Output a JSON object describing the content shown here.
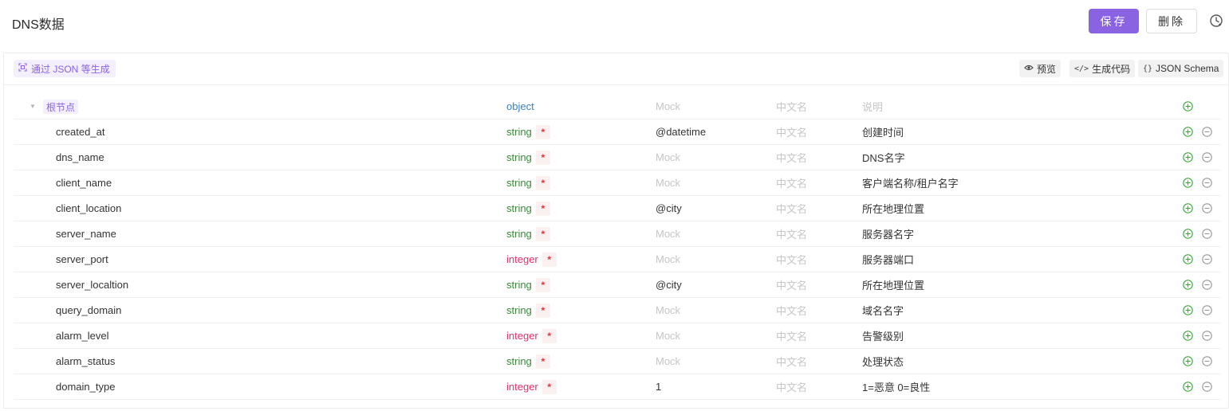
{
  "header": {
    "title": "DNS数据",
    "save_label": "保存",
    "delete_label": "删除",
    "history_icon": "history-icon"
  },
  "toolbar": {
    "generate_label": "通过 JSON 等生成",
    "preview_label": "预览",
    "codegen_label": "生成代码",
    "schema_label": "JSON Schema"
  },
  "colors": {
    "accent": "#8a63e3",
    "object_type": "#3b82c4",
    "string_type": "#3a8a3a",
    "integer_type": "#e2336e",
    "required": "#e0353b",
    "add_icon": "#3aa83a"
  },
  "schema": {
    "root": {
      "label": "根节点",
      "type": "object",
      "mock_placeholder": "Mock",
      "cn_placeholder": "中文名",
      "desc_placeholder": "说明"
    },
    "fields": [
      {
        "name": "created_at",
        "type": "string",
        "required": "*",
        "mock": "@datetime",
        "cn": "中文名",
        "desc": "创建时间"
      },
      {
        "name": "dns_name",
        "type": "string",
        "required": "*",
        "mock": "Mock",
        "cn": "中文名",
        "desc": "DNS名字"
      },
      {
        "name": "client_name",
        "type": "string",
        "required": "*",
        "mock": "Mock",
        "cn": "中文名",
        "desc": "客户端名称/租户名字"
      },
      {
        "name": "client_location",
        "type": "string",
        "required": "*",
        "mock": "@city",
        "cn": "中文名",
        "desc": "所在地理位置"
      },
      {
        "name": "server_name",
        "type": "string",
        "required": "*",
        "mock": "Mock",
        "cn": "中文名",
        "desc": "服务器名字"
      },
      {
        "name": "server_port",
        "type": "integer",
        "required": "*",
        "mock": "Mock",
        "cn": "中文名",
        "desc": "服务器端口"
      },
      {
        "name": "server_localtion",
        "type": "string",
        "required": "*",
        "mock": "@city",
        "cn": "中文名",
        "desc": "所在地理位置"
      },
      {
        "name": "query_domain",
        "type": "string",
        "required": "*",
        "mock": "Mock",
        "cn": "中文名",
        "desc": "域名名字"
      },
      {
        "name": "alarm_level",
        "type": "integer",
        "required": "*",
        "mock": "Mock",
        "cn": "中文名",
        "desc": "告警级别"
      },
      {
        "name": "alarm_status",
        "type": "string",
        "required": "*",
        "mock": "Mock",
        "cn": "中文名",
        "desc": "处理状态"
      },
      {
        "name": "domain_type",
        "type": "integer",
        "required": "*",
        "mock": "1",
        "cn": "中文名",
        "desc": "1=恶意 0=良性"
      }
    ]
  }
}
